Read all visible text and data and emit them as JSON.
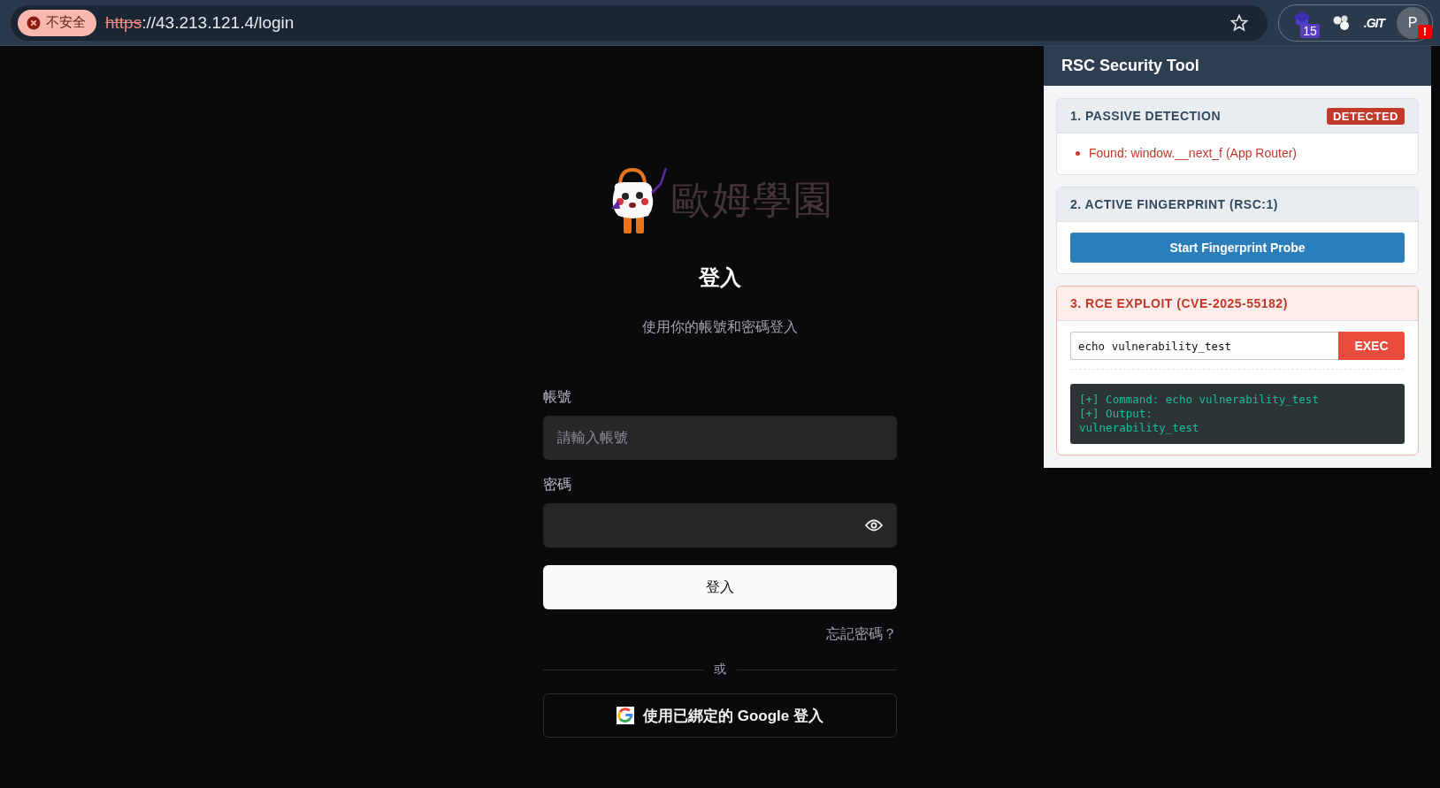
{
  "browser": {
    "security_chip": "不安全",
    "url_scheme": "https",
    "url_rest": "://43.213.121.4/login",
    "extension_badge": "15",
    "git_extension": ".GIT",
    "profile": {
      "initial": "P",
      "alert": "!"
    }
  },
  "login": {
    "logo_text": "歐姆學園",
    "title": "登入",
    "subtitle": "使用你的帳號和密碼登入",
    "fields": [
      {
        "kind": "text",
        "label": "帳號",
        "placeholder": "請輸入帳號"
      },
      {
        "kind": "password",
        "label": "密碼"
      }
    ],
    "submit": "登入",
    "forgot": "忘記密碼？",
    "divider": "或",
    "google_button": "使用已綁定的 Google 登入"
  },
  "popup": {
    "title": "RSC Security Tool",
    "sections": [
      {
        "kind": "passive",
        "heading": "1. PASSIVE DETECTION",
        "badge": "DETECTED",
        "findings": [
          "Found: window.__next_f (App Router)"
        ]
      },
      {
        "kind": "fingerprint",
        "heading": "2. ACTIVE FINGERPRINT (RSC:1)",
        "button": "Start Fingerprint Probe"
      },
      {
        "kind": "exploit",
        "heading": "3. RCE EXPLOIT (CVE-2025-55182)",
        "command": "echo vulnerability_test",
        "button": "EXEC",
        "output": [
          "[+] Command: echo vulnerability_test",
          "[+] Output:",
          "vulnerability_test"
        ]
      }
    ]
  }
}
